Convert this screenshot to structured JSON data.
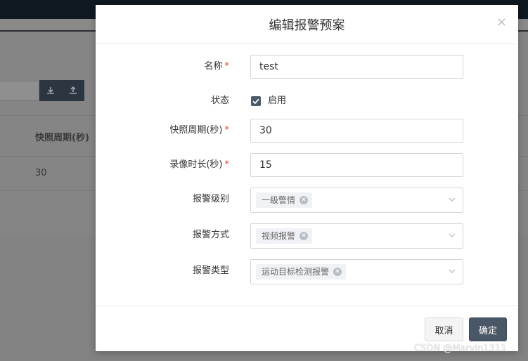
{
  "background": {
    "column_header": "快照周期(秒)",
    "cell_value": "30",
    "download_icon": "download-icon",
    "upload_icon": "upload-icon"
  },
  "modal": {
    "title": "编辑报警预案",
    "close_glyph": "×",
    "fields": {
      "name": {
        "label": "名称",
        "required": "*",
        "value": "test"
      },
      "status": {
        "label": "状态",
        "checkbox_label": "启用",
        "checked": true
      },
      "snapshot_period": {
        "label": "快照周期(秒)",
        "required": "*",
        "value": "30"
      },
      "record_duration": {
        "label": "录像时长(秒)",
        "required": "*",
        "value": "15"
      },
      "alarm_level": {
        "label": "报警级别",
        "selected": "一级警情"
      },
      "alarm_method": {
        "label": "报警方式",
        "selected": "视频报警"
      },
      "alarm_type": {
        "label": "报警类型",
        "selected": "运动目标检测报警"
      }
    },
    "footer": {
      "cancel_label": "取消",
      "ok_label": "确定"
    }
  },
  "watermark": "CSDN @Marvin1311",
  "colors": {
    "primary_button": "#4a5766",
    "required_star": "#e0443e",
    "overlay": "#8c8c8c"
  }
}
